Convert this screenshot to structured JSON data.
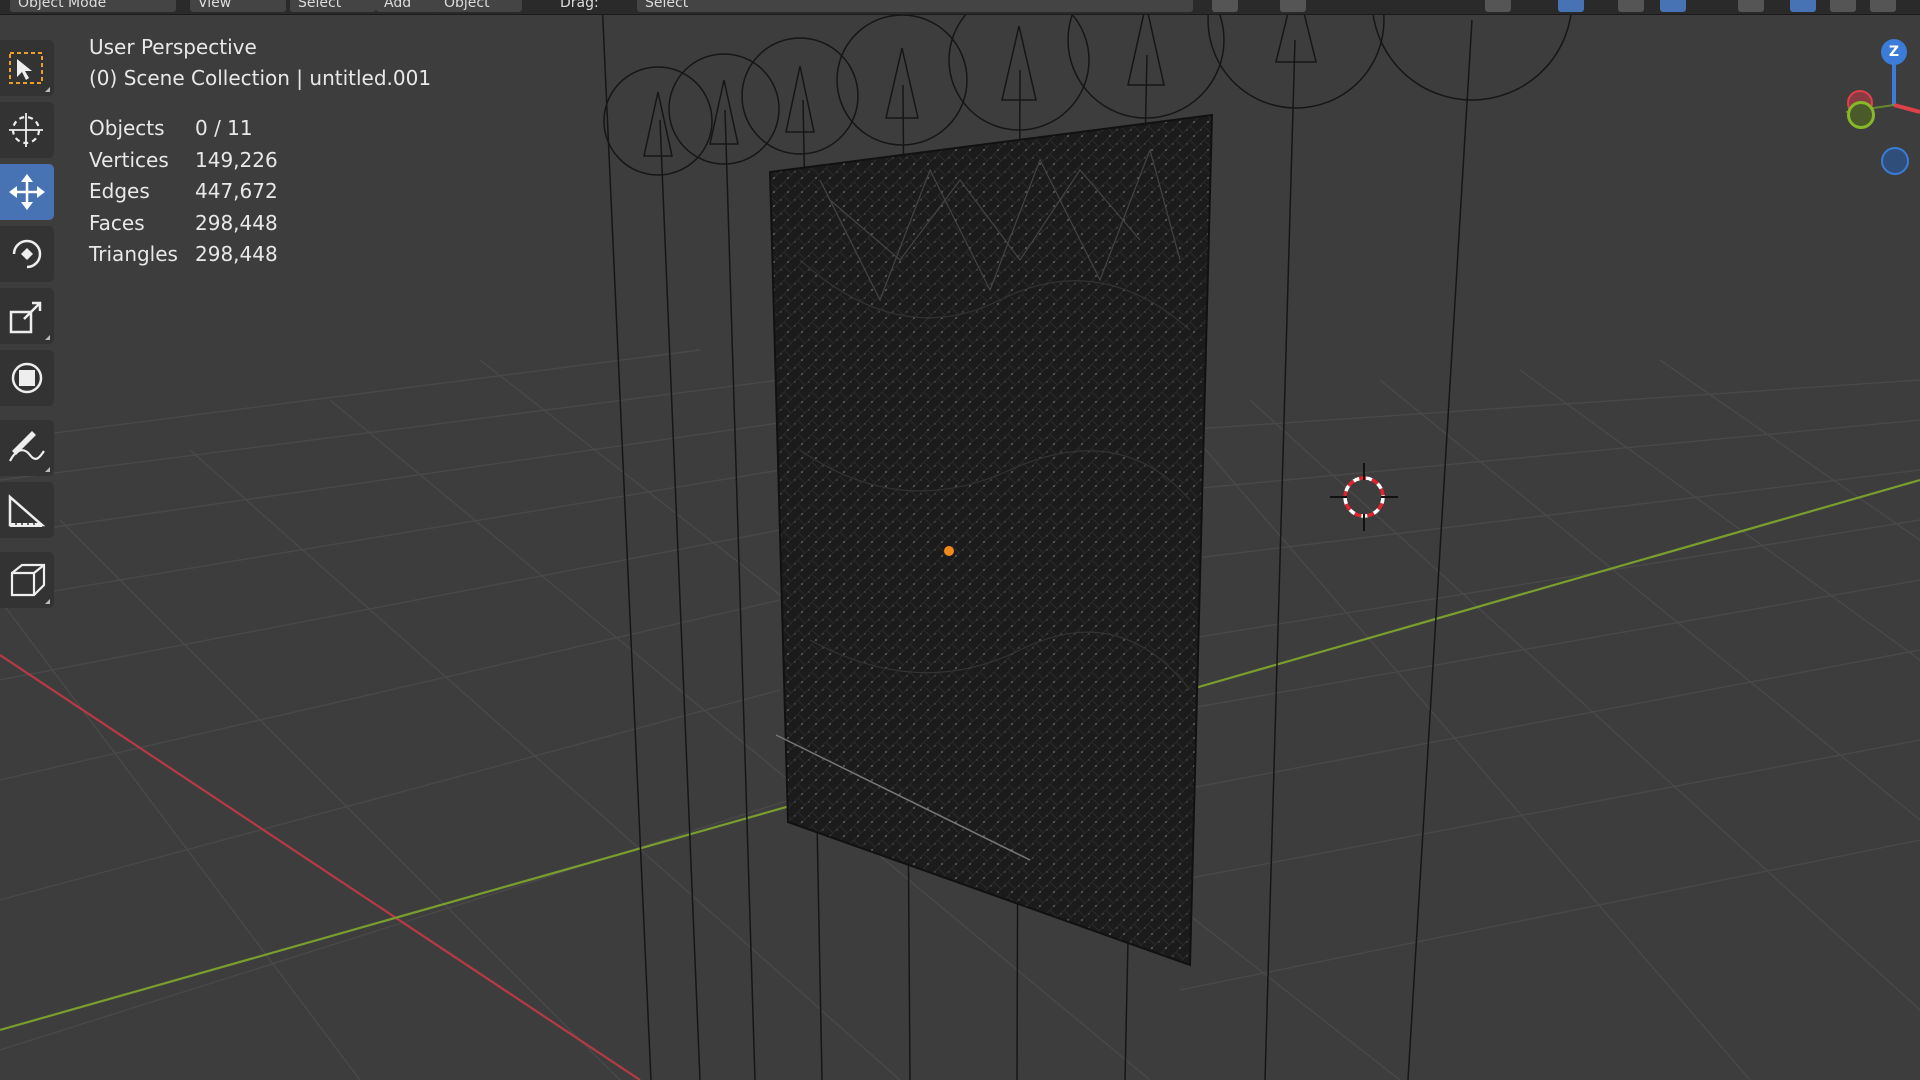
{
  "header": {
    "menu": [
      "Object Mode",
      "View",
      "Select",
      "Add",
      "Object"
    ],
    "drag_label": "Drag:",
    "select_label": "Select"
  },
  "toolbar": {
    "tools": [
      {
        "name": "select-box",
        "icon": "select-box-icon"
      },
      {
        "name": "cursor",
        "icon": "cursor-icon"
      },
      {
        "name": "move",
        "icon": "move-icon"
      },
      {
        "name": "rotate",
        "icon": "rotate-icon"
      },
      {
        "name": "scale",
        "icon": "scale-icon"
      },
      {
        "name": "transform",
        "icon": "transform-icon"
      },
      {
        "name": "annotate",
        "icon": "annotate-icon"
      },
      {
        "name": "measure",
        "icon": "measure-icon"
      },
      {
        "name": "add-cube",
        "icon": "add-cube-icon"
      }
    ],
    "active": "move"
  },
  "viewport": {
    "perspective": "User Perspective",
    "collection": "(0) Scene Collection | untitled.001"
  },
  "stats": [
    {
      "label": "Objects",
      "value": "0 / 11"
    },
    {
      "label": "Vertices",
      "value": "149,226"
    },
    {
      "label": "Edges",
      "value": "447,672"
    },
    {
      "label": "Faces",
      "value": "298,448"
    },
    {
      "label": "Triangles",
      "value": "298,448"
    }
  ],
  "gizmo": {
    "z_label": "Z",
    "colors": {
      "x": "#e0404a",
      "y": "#86b82a",
      "z": "#3a7cd8"
    }
  },
  "colors": {
    "background": "#3d3d3d",
    "grid": "#494949",
    "x_axis": "#b53a46",
    "y_axis": "#7a9e2e",
    "active_tool": "#4772b3",
    "mesh": "#1b1b1b"
  }
}
